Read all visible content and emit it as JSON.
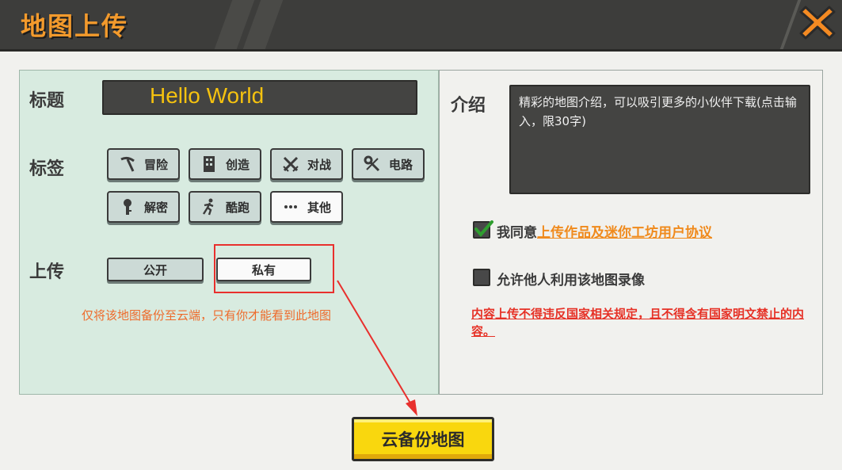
{
  "header": {
    "title": "地图上传"
  },
  "form": {
    "title_label": "标题",
    "title_value": "Hello World",
    "tags_label": "标签",
    "tags": [
      {
        "label": "冒险",
        "icon": "pickaxe-icon"
      },
      {
        "label": "创造",
        "icon": "building-icon"
      },
      {
        "label": "对战",
        "icon": "crossed-swords-icon"
      },
      {
        "label": "电路",
        "icon": "wrench-icon"
      },
      {
        "label": "解密",
        "icon": "key-icon"
      },
      {
        "label": "酷跑",
        "icon": "running-man-icon"
      },
      {
        "label": "其他",
        "icon": "ellipsis-icon"
      }
    ],
    "upload_label": "上传",
    "upload_options": [
      "公开",
      "私有"
    ],
    "upload_hint": "仅将该地图备份至云端，只有你才能看到此地图"
  },
  "right": {
    "intro_label": "介绍",
    "intro_placeholder": "精彩的地图介绍，可以吸引更多的小伙伴下载(点击输入，限30字)",
    "agree_prefix": "我同意",
    "agree_link": "上传作品及迷你工坊用户协议",
    "agree_checked": true,
    "allow_record": "允许他人利用该地图录像",
    "allow_checked": false,
    "warning": "内容上传不得违反国家相关规定，且不得含有国家明文禁止的内容。"
  },
  "footer": {
    "cloud_button": "云备份地图"
  },
  "colors": {
    "accent_orange": "#f39a2c",
    "title_yellow": "#f5c20f",
    "warning_red": "#e63126",
    "button_yellow": "#f9d70e"
  }
}
